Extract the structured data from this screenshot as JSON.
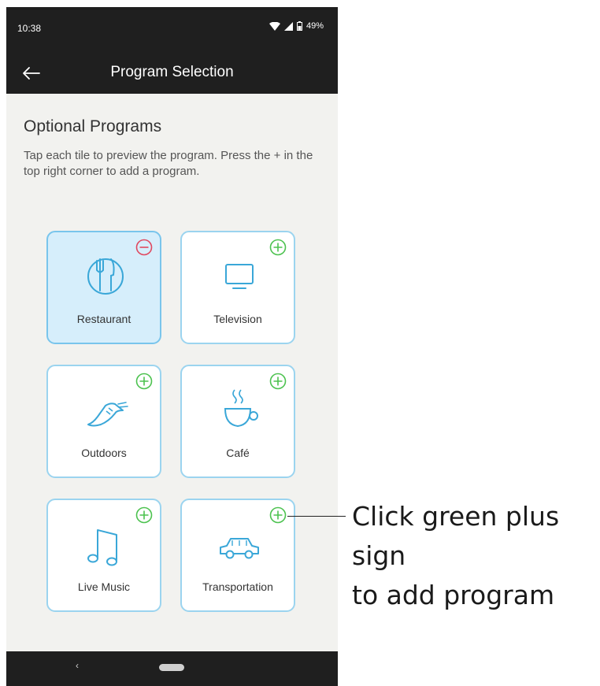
{
  "status_bar": {
    "time": "10:38",
    "battery": "49%"
  },
  "app_bar": {
    "title": "Program Selection",
    "back_icon": "back-arrow-icon"
  },
  "section": {
    "title": "Optional Programs",
    "description": "Tap each tile to preview the program. Press the + in the top right corner to add a program."
  },
  "tiles": [
    {
      "label": "Restaurant",
      "icon": "fork-knife-icon",
      "selected": true,
      "action": "remove"
    },
    {
      "label": "Television",
      "icon": "television-icon",
      "selected": false,
      "action": "add"
    },
    {
      "label": "Outdoors",
      "icon": "running-shoe-icon",
      "selected": false,
      "action": "add"
    },
    {
      "label": "Café",
      "icon": "coffee-cup-icon",
      "selected": false,
      "action": "add"
    },
    {
      "label": "Live Music",
      "icon": "music-note-icon",
      "selected": false,
      "action": "add"
    },
    {
      "label": "Transportation",
      "icon": "car-icon",
      "selected": false,
      "action": "add"
    }
  ],
  "colors": {
    "add": "#4cc24f",
    "remove": "#e0485f",
    "tile_border": "#9bd4ef",
    "tile_selected_bg": "#d6eefb",
    "bar": "#1f1f1f"
  },
  "annotation": {
    "text": "Click green plus sign\nto add program"
  }
}
